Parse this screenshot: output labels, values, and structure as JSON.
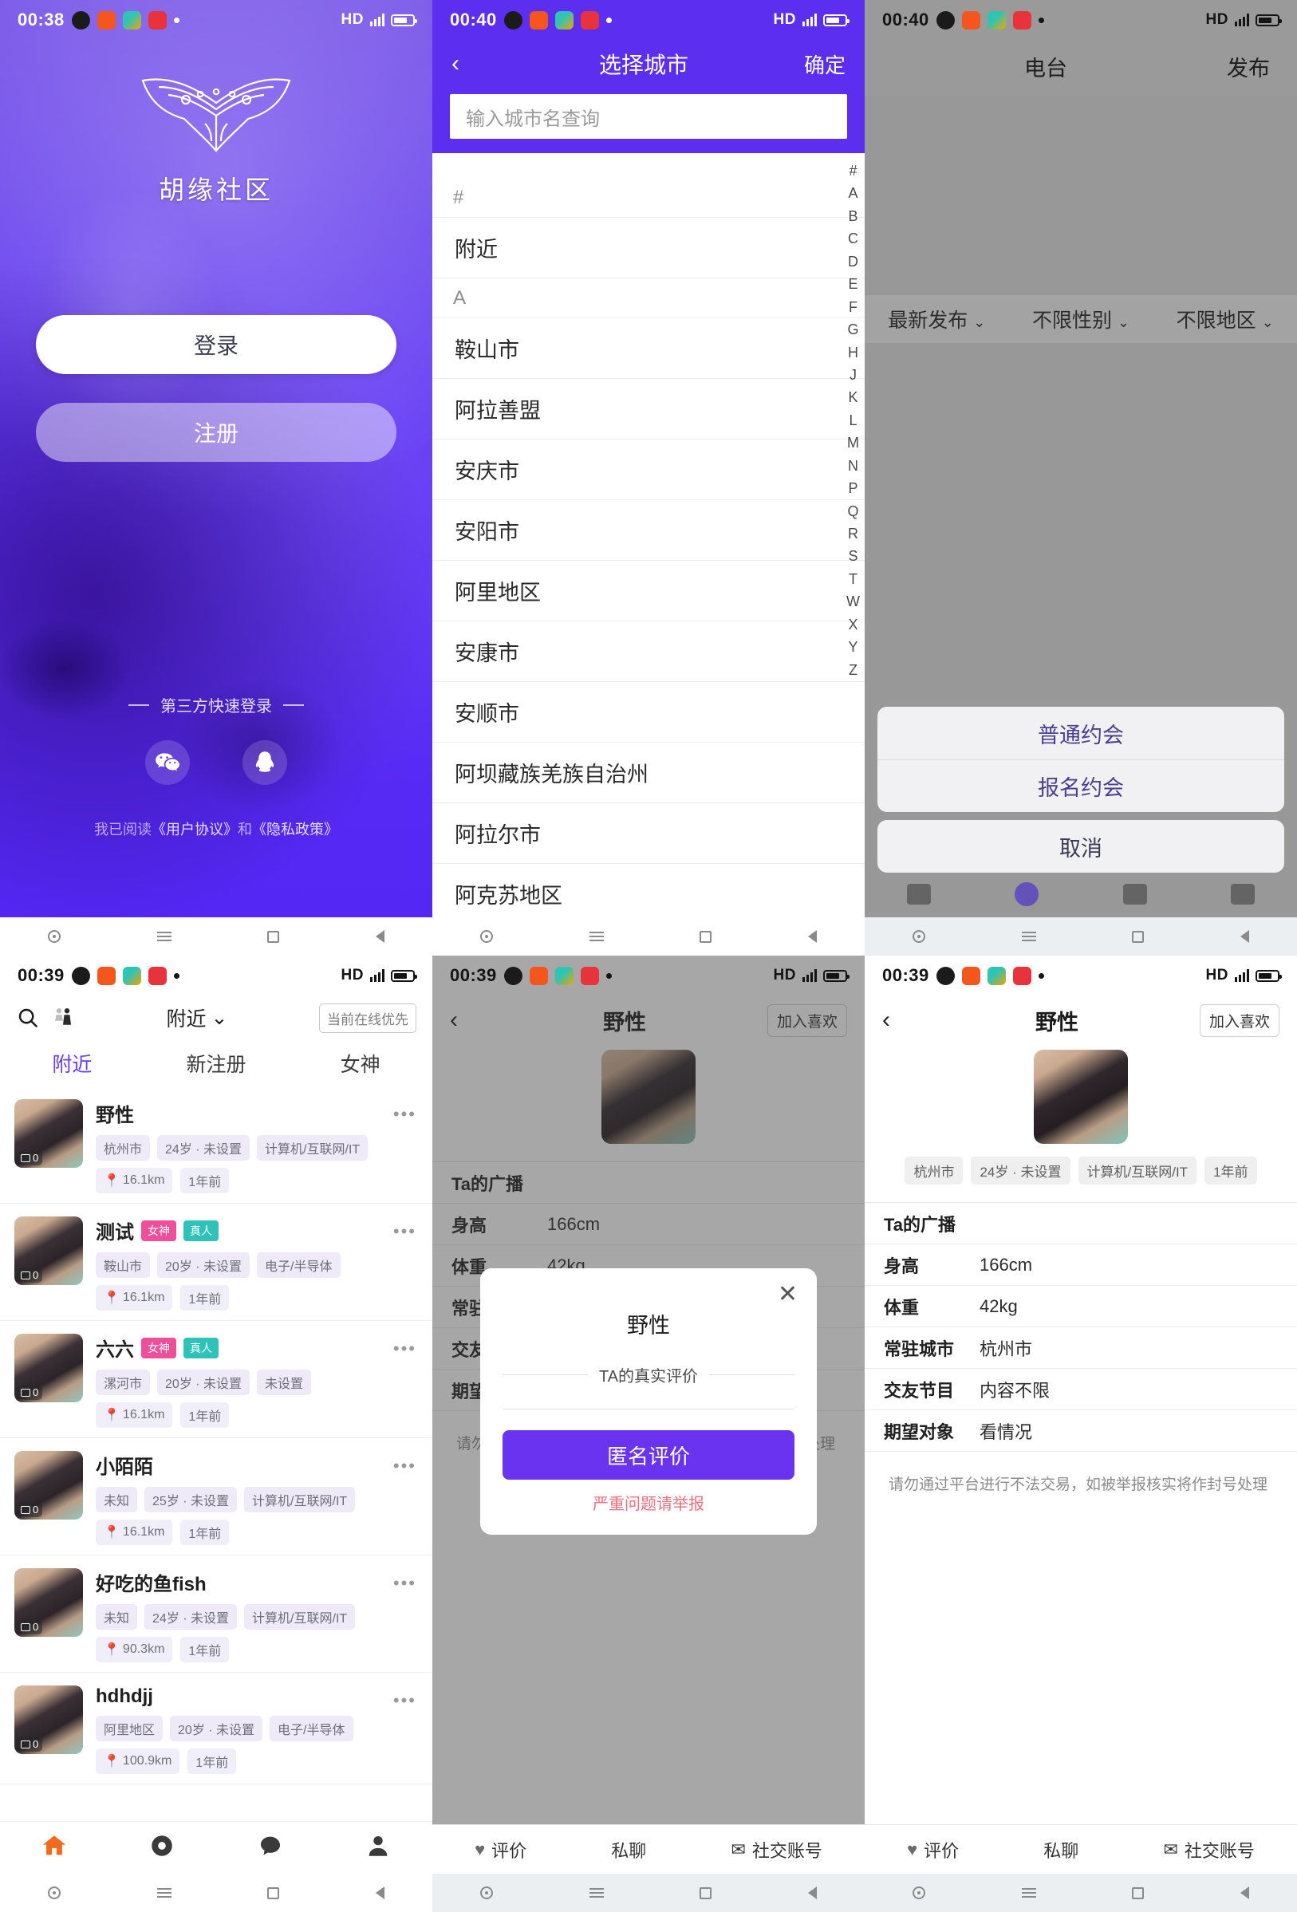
{
  "status_bars": {
    "p1": {
      "time": "00:38",
      "network": "HD",
      "icons": [
        "qq-icon",
        "orange-app-icon",
        "green-app-icon",
        "red-heart-icon",
        "dot-icon"
      ]
    },
    "p2": {
      "time": "00:40",
      "network": "HD"
    },
    "p3": {
      "time": "00:40",
      "network": "HD"
    },
    "p4": {
      "time": "00:39",
      "network": "HD"
    },
    "p5": {
      "time": "00:39",
      "network": "HD"
    },
    "p6": {
      "time": "00:39",
      "network": "HD"
    }
  },
  "splash": {
    "app_title": "胡缘社区",
    "login_label": "登录",
    "register_label": "注册",
    "third_party_label": "第三方快速登录",
    "agreement_prefix": "我已阅读",
    "agreement_user": "《用户协议》",
    "agreement_and": "和",
    "agreement_privacy": "《隐私政策》",
    "socials": [
      "wechat-icon",
      "qq-icon"
    ]
  },
  "city_picker": {
    "title": "选择城市",
    "confirm_label": "确定",
    "back_label": "‹",
    "search_placeholder": "输入城市名查询",
    "sections": [
      {
        "letter": "#",
        "cities": [
          "附近"
        ]
      },
      {
        "letter": "A",
        "cities": [
          "鞍山市",
          "阿拉善盟",
          "安庆市",
          "安阳市",
          "阿里地区",
          "安康市",
          "安顺市",
          "阿坝藏族羌族自治州",
          "阿拉尔市",
          "阿克苏地区"
        ]
      }
    ],
    "alphabet": [
      "#",
      "A",
      "B",
      "C",
      "D",
      "E",
      "F",
      "G",
      "H",
      "J",
      "K",
      "L",
      "M",
      "N",
      "P",
      "Q",
      "R",
      "S",
      "T",
      "W",
      "X",
      "Y",
      "Z"
    ]
  },
  "radio_page": {
    "tab_center": "电台",
    "tab_right": "发布",
    "filters": [
      {
        "label": "最新发布",
        "icon": "chevron-down-icon"
      },
      {
        "label": "不限性别",
        "icon": "chevron-down-icon"
      },
      {
        "label": "不限地区",
        "icon": "chevron-down-icon"
      }
    ],
    "action_sheet": {
      "options": [
        "普通约会",
        "报名约会"
      ],
      "cancel": "取消"
    }
  },
  "nearby": {
    "header": {
      "location": "附近",
      "chevron": "⌄",
      "online_pill": "当前在线优先",
      "search_icon": "search-icon",
      "filter_icon": "gender-filter-icon"
    },
    "tabs": [
      {
        "label": "附近",
        "active": true
      },
      {
        "label": "新注册",
        "active": false
      },
      {
        "label": "女神",
        "active": false
      }
    ],
    "users": [
      {
        "name": "野性",
        "badges": [],
        "tags": [
          "杭州市",
          "24岁 · 未设置",
          "计算机/互联网/IT"
        ],
        "distance": "16.1km",
        "time": "1年前",
        "photo_count": "0"
      },
      {
        "name": "测试",
        "badges": [
          "女神",
          "真人"
        ],
        "tags": [
          "鞍山市",
          "20岁 · 未设置",
          "电子/半导体"
        ],
        "distance": "16.1km",
        "time": "1年前",
        "photo_count": "0"
      },
      {
        "name": "六六",
        "badges": [
          "女神",
          "真人"
        ],
        "tags": [
          "漯河市",
          "20岁 · 未设置",
          "未设置"
        ],
        "distance": "16.1km",
        "time": "1年前",
        "photo_count": "0"
      },
      {
        "name": "小陌陌",
        "badges": [],
        "tags": [
          "未知",
          "25岁 · 未设置",
          "计算机/互联网/IT"
        ],
        "distance": "16.1km",
        "time": "1年前",
        "photo_count": "0"
      },
      {
        "name": "好吃的鱼fish",
        "badges": [],
        "tags": [
          "未知",
          "24岁 · 未设置",
          "计算机/互联网/IT"
        ],
        "distance": "90.3km",
        "time": "1年前",
        "photo_count": "0"
      },
      {
        "name": "hdhdjj",
        "badges": [],
        "tags": [
          "阿里地区",
          "20岁 · 未设置",
          "电子/半导体"
        ],
        "distance": "100.9km",
        "time": "1年前",
        "photo_count": "0"
      }
    ],
    "tabbar": [
      "home-icon",
      "discover-icon",
      "message-icon",
      "profile-icon"
    ]
  },
  "profile": {
    "title": "野性",
    "back_label": "‹",
    "like_label": "加入喜欢",
    "chips": [
      "杭州市",
      "24岁 · 未设置",
      "计算机/互联网/IT",
      "1年前"
    ],
    "broadcast_label": "Ta的广播",
    "fields": [
      {
        "key": "身高",
        "value": "166cm"
      },
      {
        "key": "体重",
        "value": "42kg"
      },
      {
        "key": "常驻城市",
        "value": "杭州市"
      },
      {
        "key": "交友节目",
        "value": "内容不限"
      },
      {
        "key": "期望对象",
        "value": "看情况"
      }
    ],
    "warning": "请勿通过平台进行不法交易，如被举报核实将作封号处理",
    "footer": [
      {
        "label": "评价",
        "icon": "heart-icon"
      },
      {
        "label": "私聊",
        "icon": ""
      },
      {
        "label": "社交账号",
        "icon": "mail-icon"
      }
    ]
  },
  "review_modal": {
    "title": "野性",
    "divider_label": "TA的真实评价",
    "cta_label": "匿名评价",
    "report_label": "严重问题请举报",
    "close_icon": "close-icon"
  },
  "colors": {
    "brand_purple": "#5b2ef0",
    "cta_purple": "#6a33f0",
    "badge_pink": "#ef4f9a",
    "badge_teal": "#2fc2b8",
    "report_red": "#e8707f"
  }
}
